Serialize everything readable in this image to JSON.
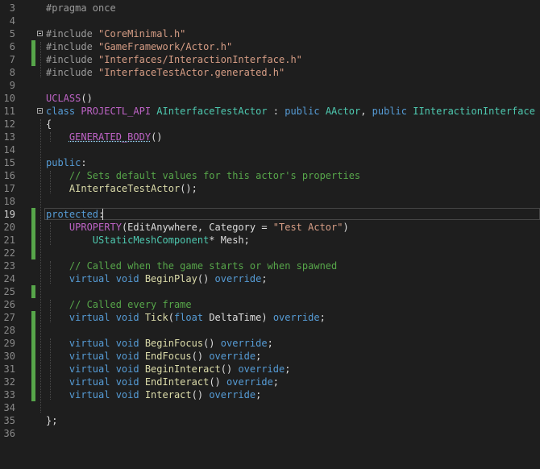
{
  "editor": {
    "lines": [
      {
        "n": "3",
        "parts": [
          {
            "t": "#pragma once",
            "c": "pp"
          }
        ]
      },
      {
        "n": "4",
        "parts": []
      },
      {
        "n": "5",
        "fold": true,
        "parts": [
          {
            "t": "#include ",
            "c": "pp"
          },
          {
            "t": "\"CoreMinimal.h\"",
            "c": "str"
          }
        ]
      },
      {
        "n": "6",
        "changed": true,
        "parts": [
          {
            "t": "#include ",
            "c": "pp"
          },
          {
            "t": "\"GameFramework/Actor.h\"",
            "c": "str"
          }
        ]
      },
      {
        "n": "7",
        "changed": true,
        "parts": [
          {
            "t": "#include ",
            "c": "pp"
          },
          {
            "t": "\"Interfaces/InteractionInterface.h\"",
            "c": "str"
          }
        ]
      },
      {
        "n": "8",
        "parts": [
          {
            "t": "#include ",
            "c": "pp"
          },
          {
            "t": "\"InterfaceTestActor.generated.h\"",
            "c": "str"
          }
        ]
      },
      {
        "n": "9",
        "parts": []
      },
      {
        "n": "10",
        "parts": [
          {
            "t": "UCLASS",
            "c": "mac"
          },
          {
            "t": "()",
            "c": "tx"
          }
        ]
      },
      {
        "n": "11",
        "fold": true,
        "parts": [
          {
            "t": "class ",
            "c": "kw"
          },
          {
            "t": "PROJECTL_API ",
            "c": "mac"
          },
          {
            "t": "AInterfaceTestActor",
            "c": "ty"
          },
          {
            "t": " : ",
            "c": "tx"
          },
          {
            "t": "public ",
            "c": "kw"
          },
          {
            "t": "AActor",
            "c": "ty"
          },
          {
            "t": ", ",
            "c": "tx"
          },
          {
            "t": "public ",
            "c": "kw"
          },
          {
            "t": "IInteractionInterface",
            "c": "ty"
          }
        ]
      },
      {
        "n": "12",
        "parts": [
          {
            "t": "{",
            "c": "tx"
          }
        ]
      },
      {
        "n": "13",
        "parts": [
          {
            "t": "    ",
            "c": "tx"
          },
          {
            "t": "GENERATED_BODY",
            "c": "mac",
            "u": true
          },
          {
            "t": "()",
            "c": "tx"
          }
        ]
      },
      {
        "n": "14",
        "parts": []
      },
      {
        "n": "15",
        "parts": [
          {
            "t": "public",
            "c": "kw"
          },
          {
            "t": ":",
            "c": "tx"
          }
        ]
      },
      {
        "n": "16",
        "parts": [
          {
            "t": "    ",
            "c": "tx"
          },
          {
            "t": "// Sets default values for this actor's properties",
            "c": "cm"
          }
        ]
      },
      {
        "n": "17",
        "parts": [
          {
            "t": "    ",
            "c": "tx"
          },
          {
            "t": "AInterfaceTestActor",
            "c": "fn"
          },
          {
            "t": "();",
            "c": "tx"
          }
        ]
      },
      {
        "n": "18",
        "parts": []
      },
      {
        "n": "19",
        "changed": true,
        "current": true,
        "parts": [
          {
            "t": "protected",
            "c": "kw"
          },
          {
            "t": ":",
            "c": "tx"
          }
        ]
      },
      {
        "n": "20",
        "changed": true,
        "parts": [
          {
            "t": "    ",
            "c": "tx"
          },
          {
            "t": "UPROPERTY",
            "c": "mac"
          },
          {
            "t": "(EditAnywhere, Category = ",
            "c": "tx"
          },
          {
            "t": "\"Test Actor\"",
            "c": "str"
          },
          {
            "t": ")",
            "c": "tx"
          }
        ]
      },
      {
        "n": "21",
        "changed": true,
        "parts": [
          {
            "t": "        ",
            "c": "tx"
          },
          {
            "t": "UStaticMeshComponent",
            "c": "ty"
          },
          {
            "t": "* Mesh;",
            "c": "tx"
          }
        ]
      },
      {
        "n": "22",
        "changed": true,
        "parts": []
      },
      {
        "n": "23",
        "parts": [
          {
            "t": "    ",
            "c": "tx"
          },
          {
            "t": "// Called when the game starts or when spawned",
            "c": "cm"
          }
        ]
      },
      {
        "n": "24",
        "parts": [
          {
            "t": "    ",
            "c": "tx"
          },
          {
            "t": "virtual ",
            "c": "kw"
          },
          {
            "t": "void ",
            "c": "kw"
          },
          {
            "t": "BeginPlay",
            "c": "fn"
          },
          {
            "t": "() ",
            "c": "tx"
          },
          {
            "t": "override",
            "c": "kw"
          },
          {
            "t": ";",
            "c": "tx"
          }
        ]
      },
      {
        "n": "25",
        "changed": true,
        "parts": []
      },
      {
        "n": "26",
        "parts": [
          {
            "t": "    ",
            "c": "tx"
          },
          {
            "t": "// Called every frame",
            "c": "cm"
          }
        ]
      },
      {
        "n": "27",
        "changed": true,
        "parts": [
          {
            "t": "    ",
            "c": "tx"
          },
          {
            "t": "virtual ",
            "c": "kw"
          },
          {
            "t": "void ",
            "c": "kw"
          },
          {
            "t": "Tick",
            "c": "fn"
          },
          {
            "t": "(",
            "c": "tx"
          },
          {
            "t": "float ",
            "c": "kw"
          },
          {
            "t": "DeltaTime) ",
            "c": "tx"
          },
          {
            "t": "override",
            "c": "kw"
          },
          {
            "t": ";",
            "c": "tx"
          }
        ]
      },
      {
        "n": "28",
        "changed": true,
        "parts": []
      },
      {
        "n": "29",
        "changed": true,
        "parts": [
          {
            "t": "    ",
            "c": "tx"
          },
          {
            "t": "virtual ",
            "c": "kw"
          },
          {
            "t": "void ",
            "c": "kw"
          },
          {
            "t": "BeginFocus",
            "c": "fn"
          },
          {
            "t": "() ",
            "c": "tx"
          },
          {
            "t": "override",
            "c": "kw"
          },
          {
            "t": ";",
            "c": "tx"
          }
        ]
      },
      {
        "n": "30",
        "changed": true,
        "parts": [
          {
            "t": "    ",
            "c": "tx"
          },
          {
            "t": "virtual ",
            "c": "kw"
          },
          {
            "t": "void ",
            "c": "kw"
          },
          {
            "t": "EndFocus",
            "c": "fn"
          },
          {
            "t": "() ",
            "c": "tx"
          },
          {
            "t": "override",
            "c": "kw"
          },
          {
            "t": ";",
            "c": "tx"
          }
        ]
      },
      {
        "n": "31",
        "changed": true,
        "parts": [
          {
            "t": "    ",
            "c": "tx"
          },
          {
            "t": "virtual ",
            "c": "kw"
          },
          {
            "t": "void ",
            "c": "kw"
          },
          {
            "t": "BeginInteract",
            "c": "fn"
          },
          {
            "t": "() ",
            "c": "tx"
          },
          {
            "t": "override",
            "c": "kw"
          },
          {
            "t": ";",
            "c": "tx"
          }
        ]
      },
      {
        "n": "32",
        "changed": true,
        "parts": [
          {
            "t": "    ",
            "c": "tx"
          },
          {
            "t": "virtual ",
            "c": "kw"
          },
          {
            "t": "void ",
            "c": "kw"
          },
          {
            "t": "EndInteract",
            "c": "fn"
          },
          {
            "t": "() ",
            "c": "tx"
          },
          {
            "t": "override",
            "c": "kw"
          },
          {
            "t": ";",
            "c": "tx"
          }
        ]
      },
      {
        "n": "33",
        "changed": true,
        "parts": [
          {
            "t": "    ",
            "c": "tx"
          },
          {
            "t": "virtual ",
            "c": "kw"
          },
          {
            "t": "void ",
            "c": "kw"
          },
          {
            "t": "Interact",
            "c": "fn"
          },
          {
            "t": "() ",
            "c": "tx"
          },
          {
            "t": "override",
            "c": "kw"
          },
          {
            "t": ";",
            "c": "tx"
          }
        ]
      },
      {
        "n": "34",
        "parts": []
      },
      {
        "n": "35",
        "parts": [
          {
            "t": "};",
            "c": "tx"
          }
        ]
      },
      {
        "n": "36",
        "parts": []
      }
    ]
  },
  "colors": {
    "background": "#1e1e1e",
    "keyword": "#569cd6",
    "string": "#d69d85",
    "comment": "#57a64a",
    "type": "#4ec9b0",
    "macro": "#bd63c5",
    "function": "#dcdcaa",
    "change_bar": "#57a64a"
  }
}
